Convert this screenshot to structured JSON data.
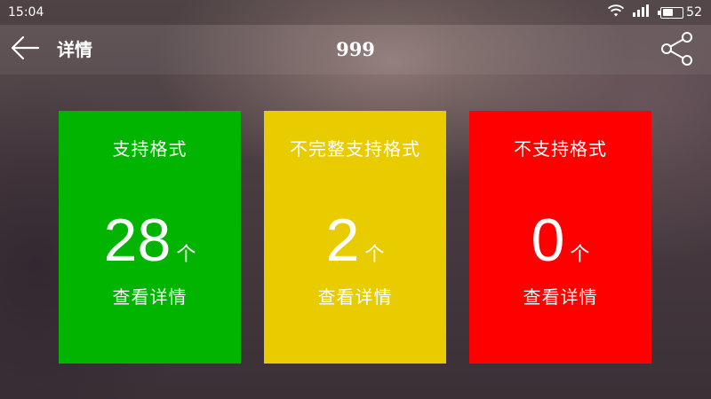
{
  "status_bar": {
    "time": "15:04",
    "battery_level": "52",
    "battery_fraction": 0.52
  },
  "header": {
    "back_icon": "arrow-left-icon",
    "title": "详情",
    "center_title": "999",
    "share_icon": "share-icon"
  },
  "cards": [
    {
      "title": "支持格式",
      "count": "28",
      "unit": "个",
      "link": "查看详情",
      "color": "#00b400"
    },
    {
      "title": "不完整支持格式",
      "count": "2",
      "unit": "个",
      "link": "查看详情",
      "color": "#e8cc00"
    },
    {
      "title": "不支持格式",
      "count": "0",
      "unit": "个",
      "link": "查看详情",
      "color": "#ff0000"
    }
  ]
}
